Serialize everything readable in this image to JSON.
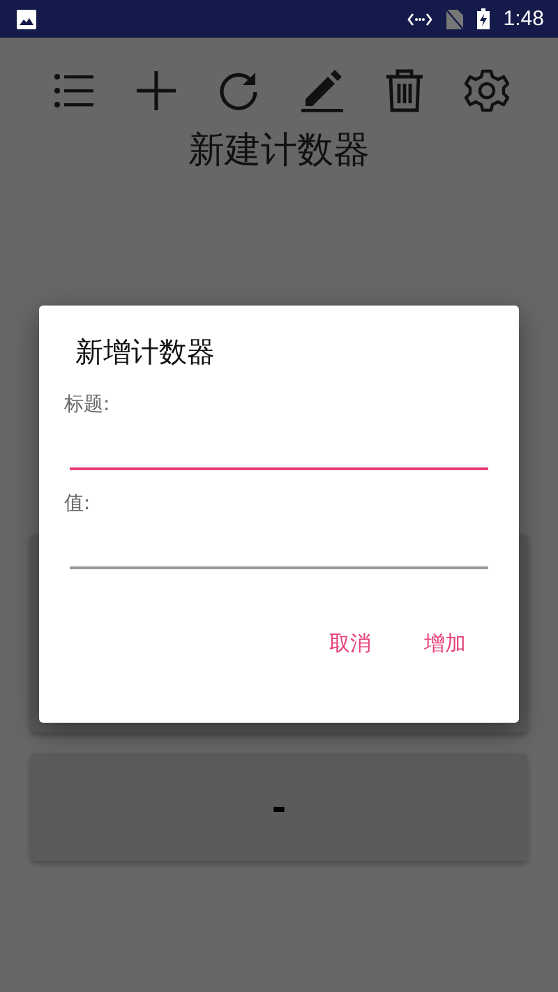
{
  "status_bar": {
    "time": "1:48"
  },
  "page_title": "新建计数器",
  "counter_button": {
    "label": "-"
  },
  "dialog": {
    "title": "新增计数器",
    "fields": [
      {
        "label": "标题:",
        "focused": true
      },
      {
        "label": "值:",
        "focused": false
      }
    ],
    "buttons": [
      "取消",
      "增加"
    ]
  }
}
